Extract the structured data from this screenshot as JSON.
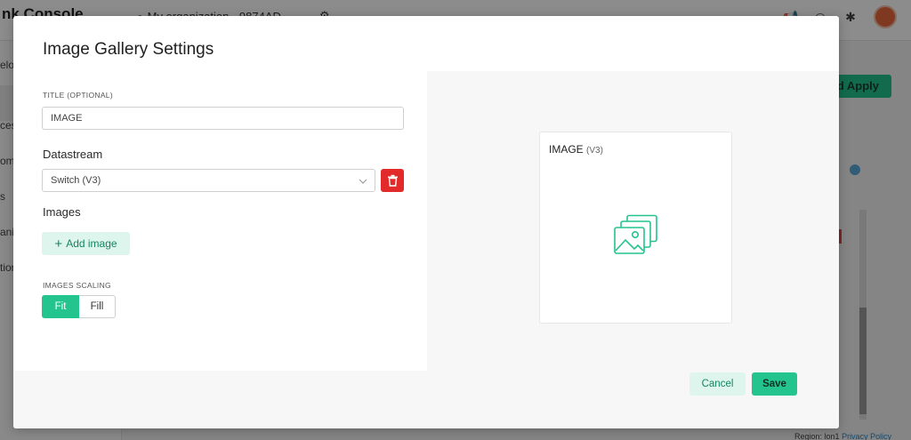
{
  "background": {
    "brand": "nk Console",
    "org_label": "My organization - 9874AD",
    "apply_button": "nd Apply",
    "sidebar_items": [
      "elop",
      "ces",
      "oma",
      "s",
      "aniz",
      "tion"
    ],
    "footer_region": "Region: lon1",
    "footer_privacy": "Privacy Policy"
  },
  "modal": {
    "title": "Image Gallery Settings",
    "title_field_label": "TITLE (OPTIONAL)",
    "title_field_value": "IMAGE",
    "datastream_label": "Datastream",
    "datastream_value": "Switch (V3)",
    "images_label": "Images",
    "add_image_label": "Add image",
    "scaling_label": "IMAGES SCALING",
    "scaling_options": [
      "Fit",
      "Fill"
    ],
    "scaling_selected": "Fit",
    "preview_title": "IMAGE",
    "preview_datastream": "(V3)",
    "cancel_label": "Cancel",
    "save_label": "Save"
  },
  "colors": {
    "accent": "#23c48e",
    "accent_light": "#def5ed",
    "danger": "#e22a2a"
  },
  "icons": [
    "chevron-down-icon",
    "trash-icon",
    "plus-icon",
    "image-gallery-icon",
    "settings-icon",
    "bell-icon",
    "bug-icon",
    "megaphone-icon"
  ]
}
